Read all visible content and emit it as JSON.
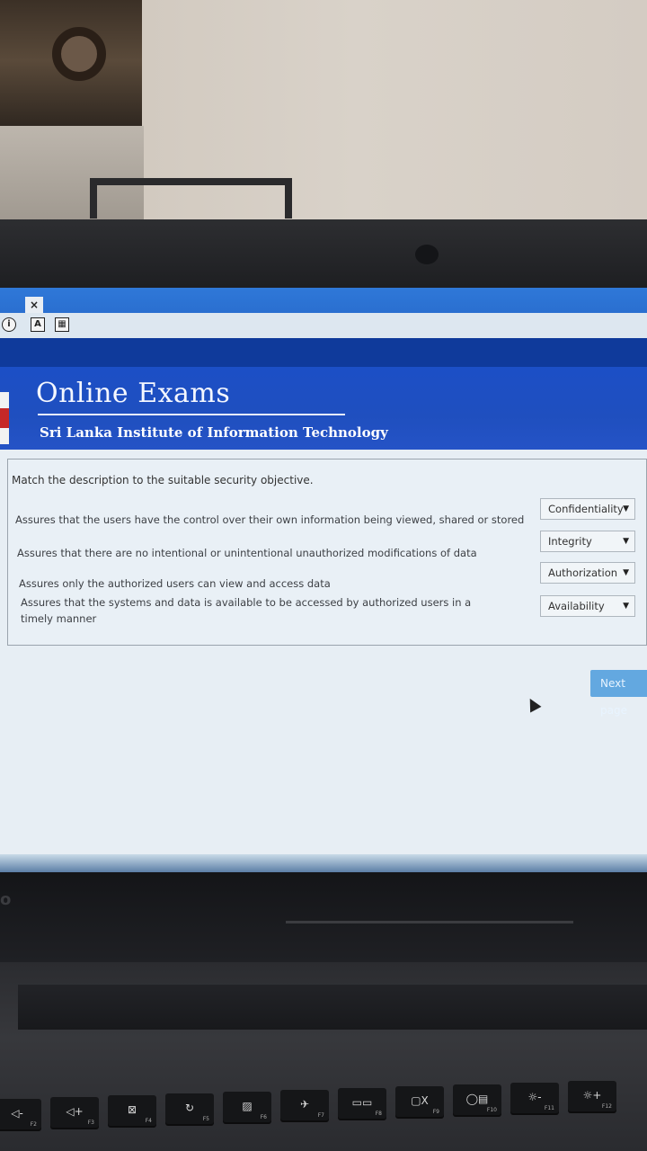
{
  "window": {
    "close_label": "×"
  },
  "toolbar": {
    "icons": [
      "info-icon",
      "font-icon",
      "calculator-icon"
    ],
    "info_glyph": "i",
    "font_glyph": "A",
    "calc_glyph": "▦"
  },
  "header": {
    "title": "Online Exams",
    "subtitle": "Sri Lanka Institute of Information Technology"
  },
  "question": {
    "prompt": "Match the description to the suitable security objective.",
    "rows": [
      {
        "text": "Assures that the users have the control over their own information being viewed, shared or stored",
        "selected": "Confidentiality"
      },
      {
        "text": "Assures that  there are no intentional or unintentional unauthorized modifications of data",
        "selected": "Integrity"
      },
      {
        "text": "Assures only the authorized users can view and access data",
        "selected": "Authorization"
      },
      {
        "text": "Assures that the systems and data is available to be accessed by authorized users in a timely manner",
        "selected": "Availability"
      }
    ],
    "dropdown_arrow": "▼"
  },
  "navigation": {
    "next_label": "Next page"
  },
  "laptop": {
    "brand": "o"
  },
  "keyboard": {
    "keys": [
      {
        "label": "◁-",
        "fn": "F2"
      },
      {
        "label": "◁+",
        "fn": "F3"
      },
      {
        "label": "⊠",
        "fn": "F4"
      },
      {
        "label": "↻",
        "fn": "F5"
      },
      {
        "label": "▨",
        "fn": "F6"
      },
      {
        "label": "✈",
        "fn": "F7"
      },
      {
        "label": "▭▭",
        "fn": "F8"
      },
      {
        "label": "▢X",
        "fn": "F9"
      },
      {
        "label": "◯▤",
        "fn": "F10"
      },
      {
        "label": "☼-",
        "fn": "F11"
      },
      {
        "label": "☼+",
        "fn": "F12"
      }
    ]
  },
  "colors": {
    "accent": "#1f4fbf",
    "titlebar": "#2a6fd0",
    "next_button": "#63a8e0"
  }
}
